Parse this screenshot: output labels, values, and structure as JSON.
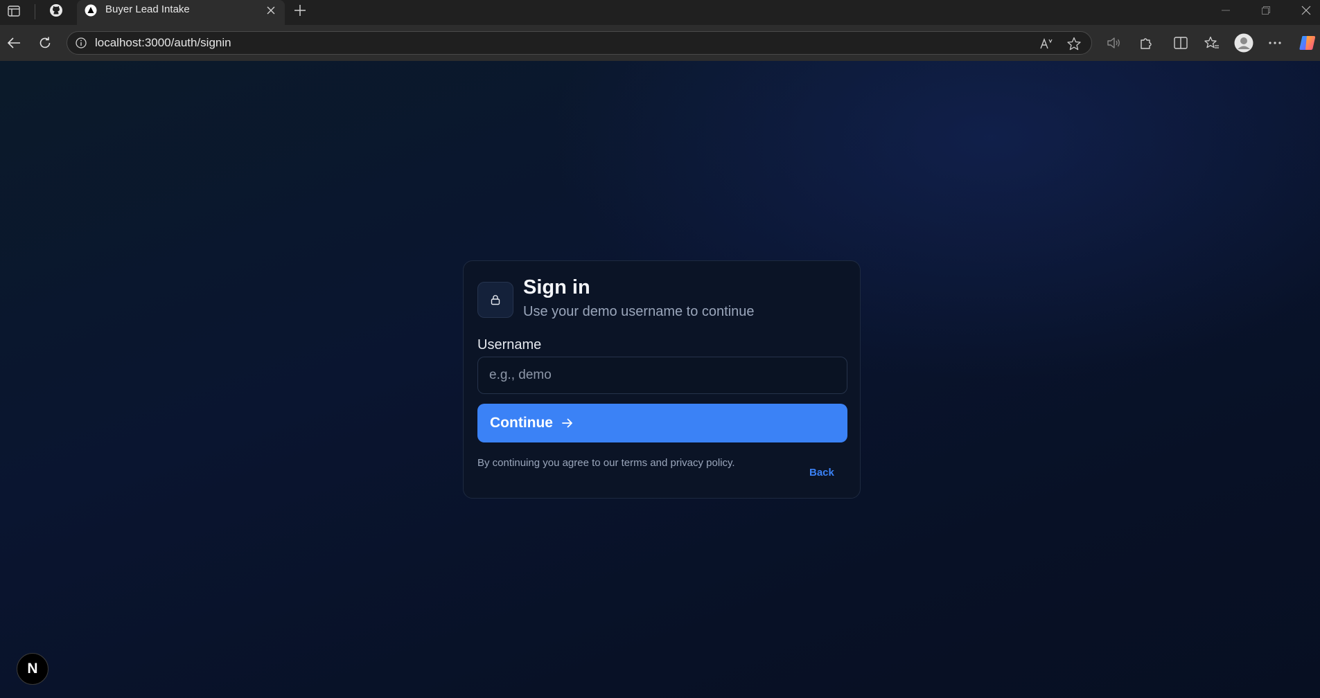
{
  "browser": {
    "tab_title": "Buyer Lead Intake",
    "url": "localhost:3000/auth/signin",
    "icons": {
      "sidebar": "sidebar-toggle-icon",
      "github": "github-icon",
      "tab_favicon": "triangle-logo-icon",
      "close_tab": "close-icon",
      "new_tab": "plus-icon",
      "back": "arrow-left-icon",
      "refresh": "refresh-icon",
      "site_info": "info-icon",
      "read_aloud": "read-aloud-icon",
      "favorite": "star-icon",
      "audio": "speaker-icon",
      "extensions": "puzzle-icon",
      "split_screen": "split-screen-icon",
      "favorites": "favorites-icon",
      "profile": "profile-icon",
      "more": "more-icon",
      "copilot": "copilot-icon"
    }
  },
  "signin": {
    "title": "Sign in",
    "subtitle": "Use your demo username to continue",
    "username_label": "Username",
    "username_placeholder": "e.g., demo",
    "username_value": "",
    "continue_label": "Continue",
    "terms_text": "By continuing you agree to our terms and privacy policy.",
    "back_label": "Back"
  },
  "nextjs_badge": "N",
  "colors": {
    "accent": "#3b82f6",
    "card_bg": "#0b1426",
    "page_bg": "#0a1224"
  }
}
